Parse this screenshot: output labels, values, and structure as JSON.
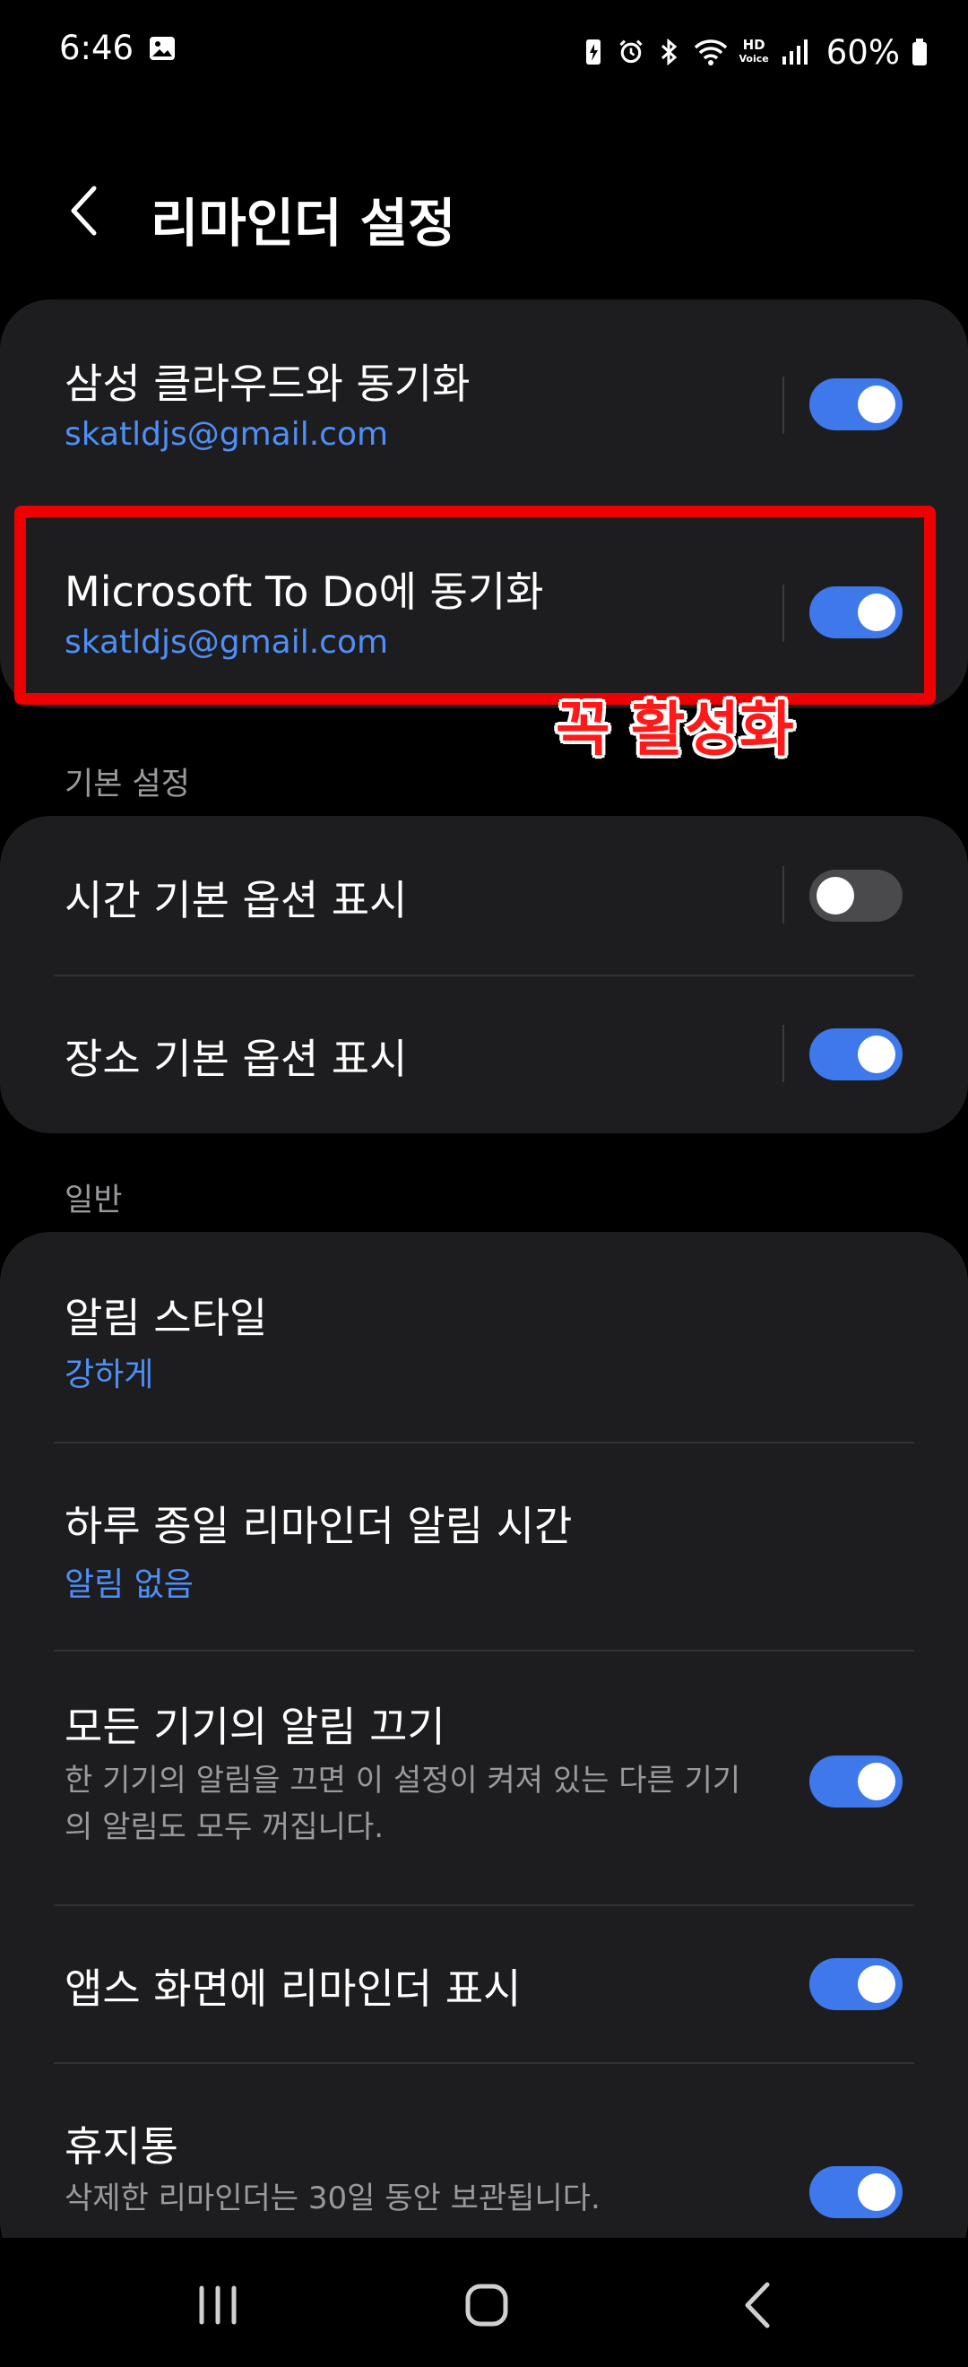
{
  "status_bar": {
    "time": "6:46",
    "battery": "60%",
    "hd_top": "HD",
    "hd_bottom": "Voice",
    "icons": [
      "image-icon",
      "battery-saver-icon",
      "alarm-icon",
      "bluetooth-icon",
      "wifi-icon",
      "hd-voice-icon",
      "signal-icon",
      "battery-icon"
    ]
  },
  "header": {
    "title": "리마인더 설정"
  },
  "sync": {
    "samsung": {
      "title": "삼성 클라우드와 동기화",
      "account": "skatldjs@gmail.com",
      "enabled": true
    },
    "microsoft": {
      "title": "Microsoft To Do에 동기화",
      "account": "skatldjs@gmail.com",
      "enabled": true
    }
  },
  "annotation": {
    "text": "꼭 활성화",
    "color": "#ff1a1a"
  },
  "basic_settings": {
    "label": "기본 설정",
    "items": [
      {
        "title": "시간 기본 옵션 표시",
        "enabled": false
      },
      {
        "title": "장소 기본 옵션 표시",
        "enabled": true
      }
    ]
  },
  "general": {
    "label": "일반",
    "alert_style": {
      "title": "알림 스타일",
      "value": "강하게"
    },
    "end_of_day": {
      "title": "하루 종일 리마인더 알림 시간",
      "value": "알림 없음"
    },
    "mute_all": {
      "title": "모든 기기의 알림 끄기",
      "description": "한 기기의 알림을 끄면 이 설정이 켜져 있는 다른 기기의 알림도 모두 꺼집니다.",
      "enabled": true
    },
    "apps_screen": {
      "title": "앱스 화면에 리마인더 표시",
      "enabled": true
    },
    "trash": {
      "title": "휴지통",
      "description": "삭제한 리마인더는 30일 동안 보관됩니다.",
      "enabled": true
    }
  },
  "colors": {
    "accent": "#3e78ea",
    "link": "#4f8ff7",
    "card": "#1d1d1f",
    "background": "#000000"
  },
  "nav_bar": {
    "icons": [
      "recents-icon",
      "home-icon",
      "back-icon"
    ]
  }
}
